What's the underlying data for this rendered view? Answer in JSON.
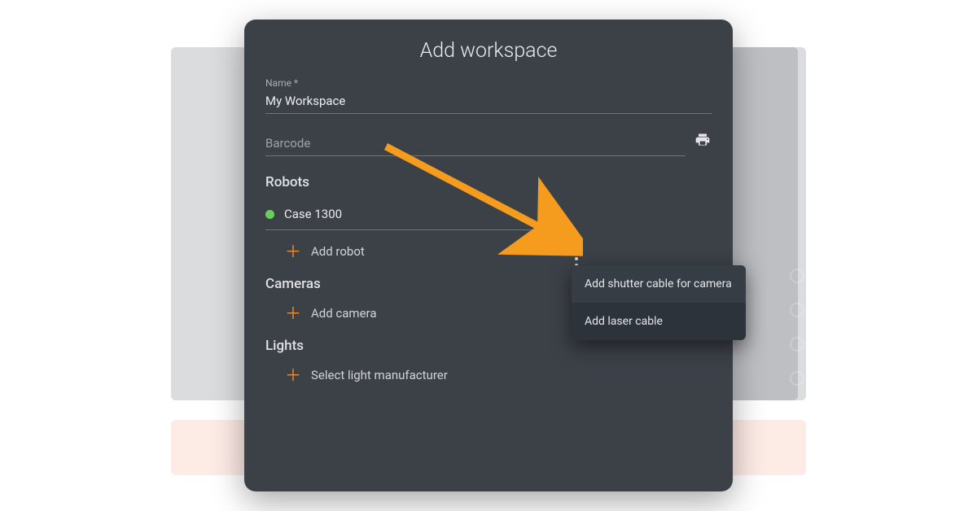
{
  "modal": {
    "title": "Add workspace",
    "name_label": "Name *",
    "name_value": "My Workspace",
    "barcode_placeholder": "Barcode"
  },
  "robots": {
    "section": "Robots",
    "selected": "Case 1300",
    "add_label": "Add robot"
  },
  "cameras": {
    "section": "Cameras",
    "add_label": "Add camera"
  },
  "lights": {
    "section": "Lights",
    "add_label": "Select light manufacturer"
  },
  "menu": {
    "items": [
      "Add shutter cable for camera",
      "Add laser cable"
    ]
  },
  "colors": {
    "accent": "#f28c30",
    "panel": "#3c4148",
    "menu": "#2d333a",
    "status_ok": "#69cf5a"
  }
}
